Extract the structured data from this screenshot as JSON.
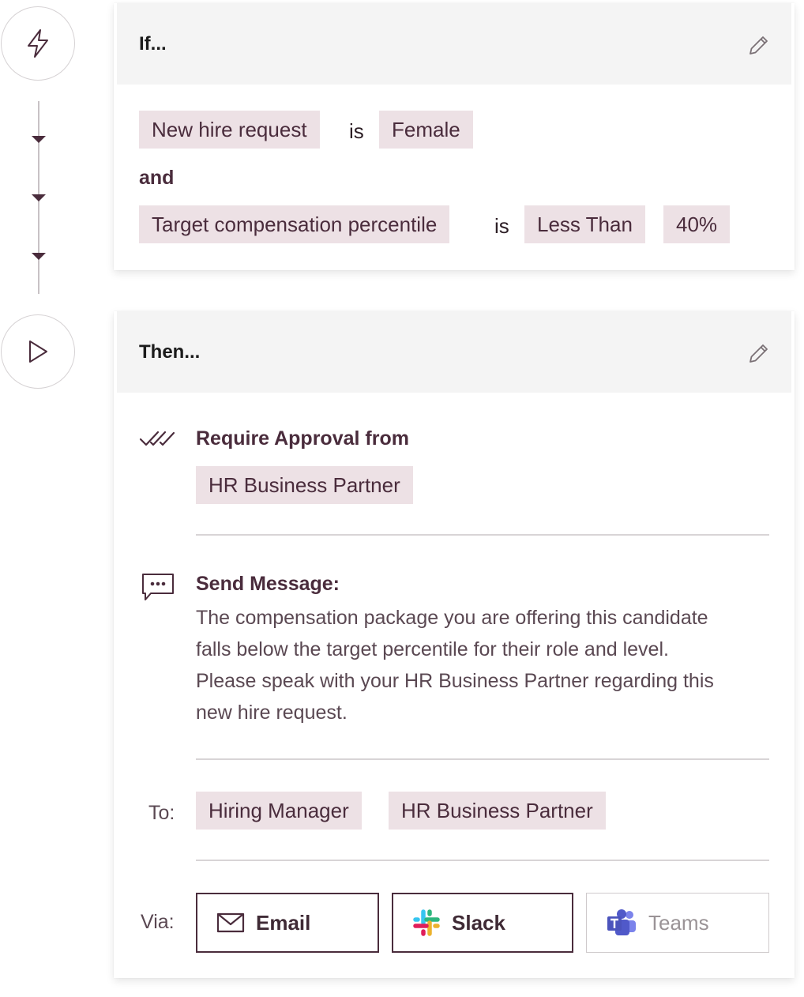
{
  "condition_card": {
    "title": "If...",
    "row1": {
      "field": "New hire request",
      "operator": "is",
      "value": "Female"
    },
    "conjunction": "and",
    "row2": {
      "field": "Target compensation percentile",
      "operator": "is",
      "comparator": "Less Than",
      "value": "40%"
    }
  },
  "action_card": {
    "title": "Then...",
    "approval": {
      "label": "Require Approval from",
      "approver": "HR Business Partner"
    },
    "message": {
      "label": "Send Message:",
      "body": "The compensation package you are offering this candidate falls below the target percentile for their role and level. Please speak with your HR Business Partner regarding this new hire request."
    },
    "recipients": {
      "label": "To:",
      "items": [
        "Hiring Manager",
        "HR Business Partner"
      ]
    },
    "channels": {
      "label": "Via:",
      "email": "Email",
      "slack": "Slack",
      "teams": "Teams"
    }
  },
  "icons": [
    "lightning-icon",
    "play-icon",
    "pencil-icon",
    "double-check-icon",
    "message-icon",
    "mail-icon",
    "slack-icon",
    "teams-icon"
  ],
  "colors": {
    "accent": "#4a2c3c",
    "chip_bg": "#ede1e5",
    "header_bg": "#f4f4f4"
  }
}
